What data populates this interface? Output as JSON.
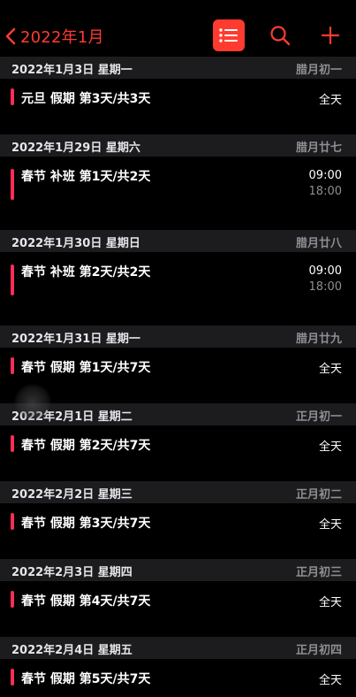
{
  "nav": {
    "back_label": "2022年1月",
    "accent": "#ff3b30",
    "icons": {
      "back": "chevron-left-icon",
      "list": "list-icon",
      "search": "search-icon",
      "add": "plus-icon"
    }
  },
  "days": [
    {
      "date": "2022年1月3日 星期一",
      "lunar": "腊月初一",
      "event": {
        "title": "元旦 假期 第3天/共3天",
        "allday": "全天",
        "color": "#ff2d55"
      }
    },
    {
      "date": "2022年1月29日 星期六",
      "lunar": "腊月廿七",
      "event": {
        "title": "春节 补班 第1天/共2天",
        "start": "09:00",
        "end": "18:00",
        "color": "#ff2d55"
      }
    },
    {
      "date": "2022年1月30日 星期日",
      "lunar": "腊月廿八",
      "event": {
        "title": "春节 补班 第2天/共2天",
        "start": "09:00",
        "end": "18:00",
        "color": "#ff2d55"
      }
    },
    {
      "date": "2022年1月31日 星期一",
      "lunar": "腊月廿九",
      "event": {
        "title": "春节 假期 第1天/共7天",
        "allday": "全天",
        "color": "#ff2d55"
      }
    },
    {
      "date": "2022年2月1日 星期二",
      "lunar": "正月初一",
      "event": {
        "title": "春节 假期 第2天/共7天",
        "allday": "全天",
        "color": "#ff2d55"
      }
    },
    {
      "date": "2022年2月2日 星期三",
      "lunar": "正月初二",
      "event": {
        "title": "春节 假期 第3天/共7天",
        "allday": "全天",
        "color": "#ff2d55"
      }
    },
    {
      "date": "2022年2月3日 星期四",
      "lunar": "正月初三",
      "event": {
        "title": "春节 假期 第4天/共7天",
        "allday": "全天",
        "color": "#ff2d55"
      }
    },
    {
      "date": "2022年2月4日 星期五",
      "lunar": "正月初四",
      "event": {
        "title": "春节 假期 第5天/共7天",
        "allday": "全天",
        "color": "#ff2d55"
      }
    }
  ]
}
